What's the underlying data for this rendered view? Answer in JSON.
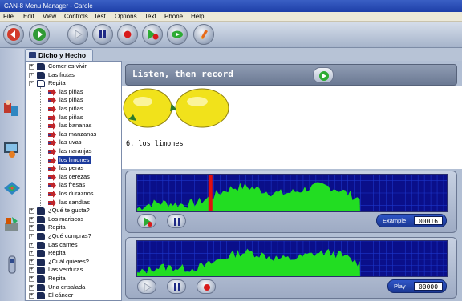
{
  "window": {
    "title": "CAN-8 Menu Manager - Carole"
  },
  "menu": [
    "File",
    "Edit",
    "View",
    "Controls",
    "Test",
    "Options",
    "Text",
    "Phone",
    "Help"
  ],
  "toolbar": {
    "buttons": [
      "back-icon",
      "forward-icon",
      "play-icon",
      "pause-icon",
      "record-icon",
      "play-record-icon",
      "compare-icon",
      "erase-icon"
    ]
  },
  "tab": {
    "label": "Dicho y Hecho"
  },
  "tree": [
    {
      "label": "Comer es vivir",
      "kind": "book",
      "expander": "+"
    },
    {
      "label": "Las frutas",
      "kind": "book",
      "expander": "+"
    },
    {
      "label": "Repita",
      "kind": "open",
      "expander": "-"
    },
    {
      "label": "las piñas",
      "kind": "item"
    },
    {
      "label": "las piñas",
      "kind": "item"
    },
    {
      "label": "las piñas",
      "kind": "item"
    },
    {
      "label": "las piñas",
      "kind": "item"
    },
    {
      "label": "las bananas",
      "kind": "item"
    },
    {
      "label": "las manzanas",
      "kind": "item"
    },
    {
      "label": "las uvas",
      "kind": "item"
    },
    {
      "label": "las naranjas",
      "kind": "item"
    },
    {
      "label": "los limones",
      "kind": "item",
      "selected": true
    },
    {
      "label": "las peras",
      "kind": "item"
    },
    {
      "label": "las cerezas",
      "kind": "item"
    },
    {
      "label": "las fresas",
      "kind": "item"
    },
    {
      "label": "los duraznos",
      "kind": "item"
    },
    {
      "label": "las sandías",
      "kind": "item"
    },
    {
      "label": "¿Qué te gusta?",
      "kind": "book",
      "expander": "+"
    },
    {
      "label": "Los mariscos",
      "kind": "book",
      "expander": "+"
    },
    {
      "label": "Repita",
      "kind": "book",
      "expander": "+"
    },
    {
      "label": "¿Qué compras?",
      "kind": "book",
      "expander": "+"
    },
    {
      "label": "Las carnes",
      "kind": "book",
      "expander": "+"
    },
    {
      "label": "Repita",
      "kind": "book",
      "expander": "+"
    },
    {
      "label": "¿Cuál quieres?",
      "kind": "book",
      "expander": "+"
    },
    {
      "label": "Las verduras",
      "kind": "book",
      "expander": "+"
    },
    {
      "label": "Repita",
      "kind": "book",
      "expander": "+"
    },
    {
      "label": "Una ensalada",
      "kind": "book",
      "expander": "+"
    },
    {
      "label": "El cáncer",
      "kind": "book",
      "expander": "+"
    }
  ],
  "lesson": {
    "header": "Listen, then record",
    "sentence": "6. los limones"
  },
  "example_panel": {
    "label": "Example",
    "counter": "00016"
  },
  "play_panel": {
    "label": "Play",
    "counter": "00000"
  },
  "colors": {
    "wave": "#22dd22",
    "scope_bg": "#0a0f8a",
    "marker": "#e01010",
    "selection": "#1b3a9c"
  }
}
